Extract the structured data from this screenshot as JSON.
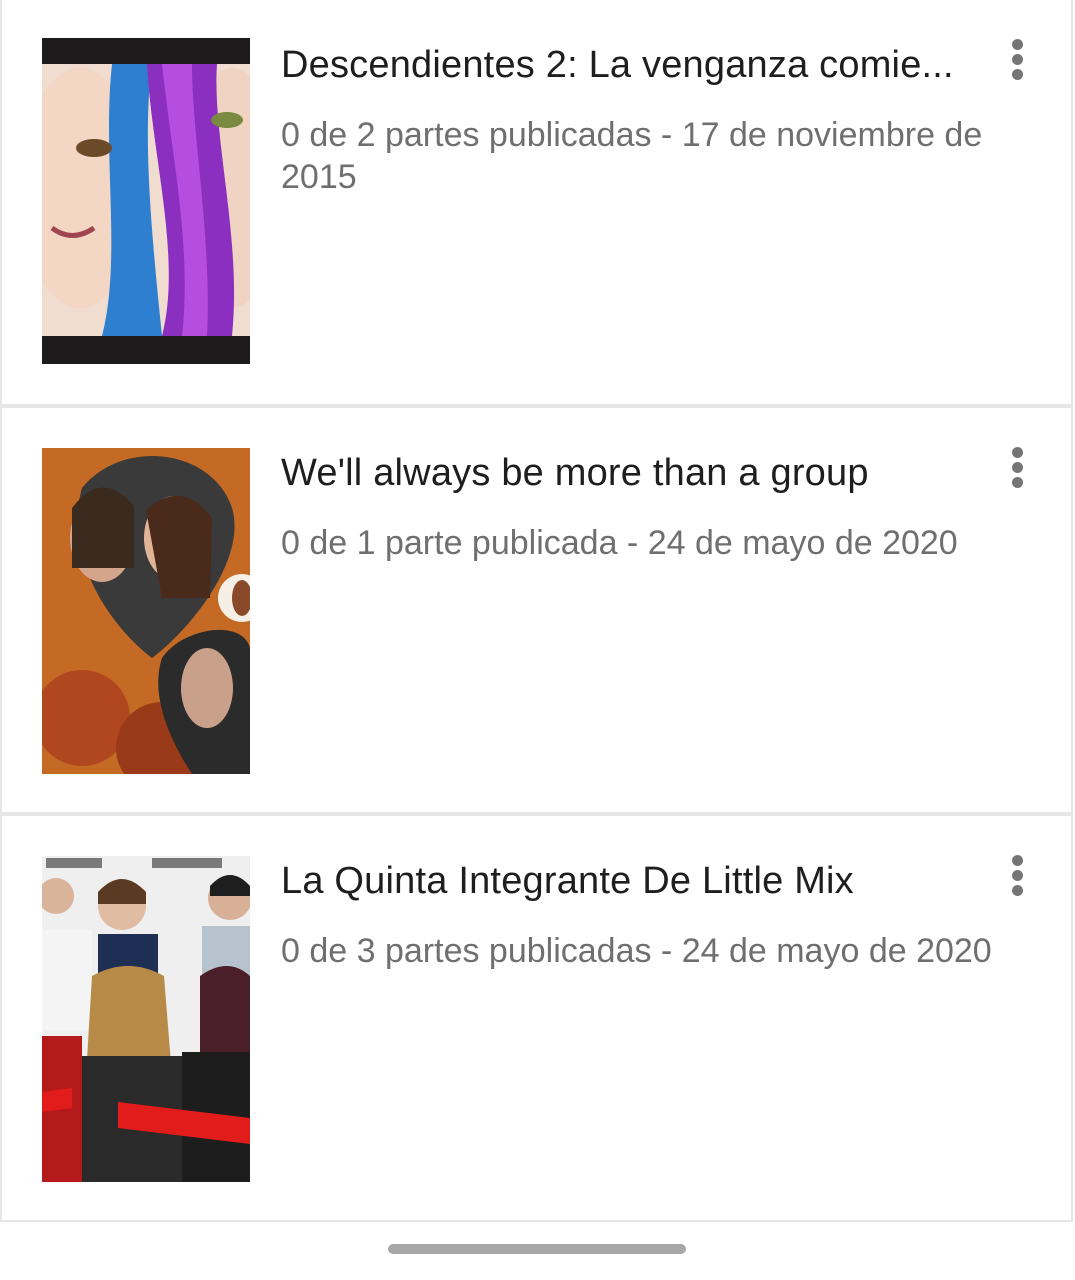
{
  "stories": [
    {
      "title": "Descendientes 2: La venganza comie...",
      "parts": "0 de 2 partes publicadas",
      "separator": " - ",
      "date": "17 de noviembre de 2015",
      "cover_icon": "cover-image-blue-purple-hair",
      "menu_icon": "more-vertical-icon"
    },
    {
      "title": "We'll always be more than a group",
      "parts": "0 de 1 parte publicada",
      "separator": " - ",
      "date": "24 de mayo de 2020",
      "cover_icon": "cover-image-heart-collage",
      "menu_icon": "more-vertical-icon"
    },
    {
      "title": "La Quinta Integrante De Little Mix",
      "parts": "0 de 3 partes publicadas",
      "separator": " - ",
      "date": "24 de mayo de 2020",
      "cover_icon": "cover-image-band-photo",
      "menu_icon": "more-vertical-icon"
    }
  ],
  "colors": {
    "title": "#1e1e1e",
    "meta": "#6f6f6f",
    "divider": "#e6e6e6",
    "menu_dots": "#757575"
  }
}
